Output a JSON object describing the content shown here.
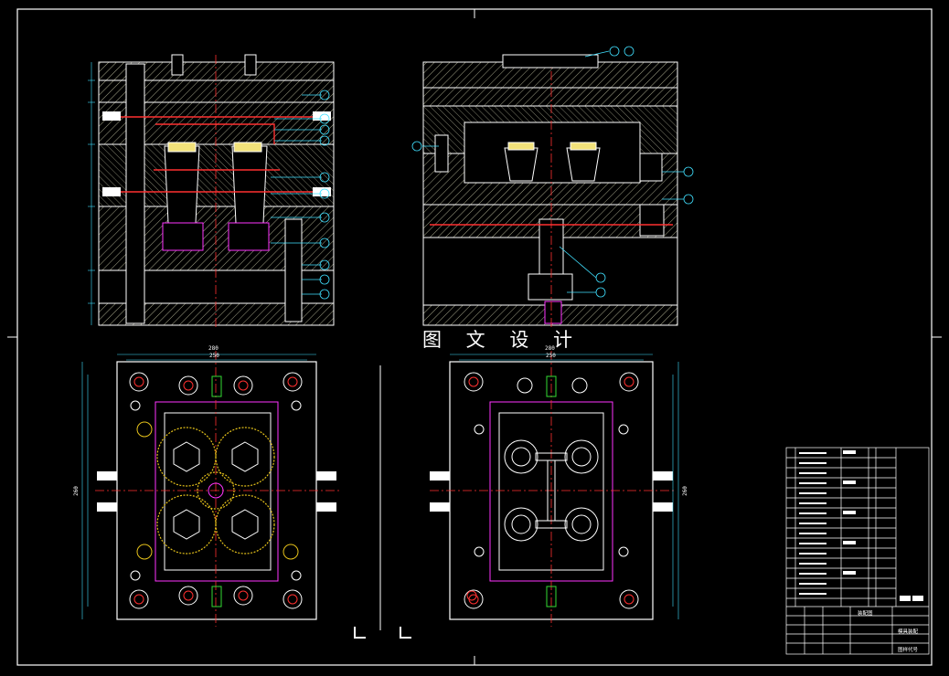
{
  "watermark": "图 文 设 计",
  "dimensions": {
    "left_top_width": "280",
    "left_inner_width": "250",
    "right_top_width": "280",
    "right_inner_width": "250",
    "left_height": "260",
    "right_height": "260"
  },
  "title_block": {
    "name_cell": "装配图",
    "drawing_title": "模具装配",
    "drawing_no": "图样代号"
  },
  "colors": {
    "frame": "#ffffff",
    "hatch": "#bfbf9f",
    "centerline": "#ff3030",
    "gear": "#e6c21a",
    "leader": "#40e0ff",
    "magenta": "#ff33ff",
    "green": "#33dd33"
  }
}
